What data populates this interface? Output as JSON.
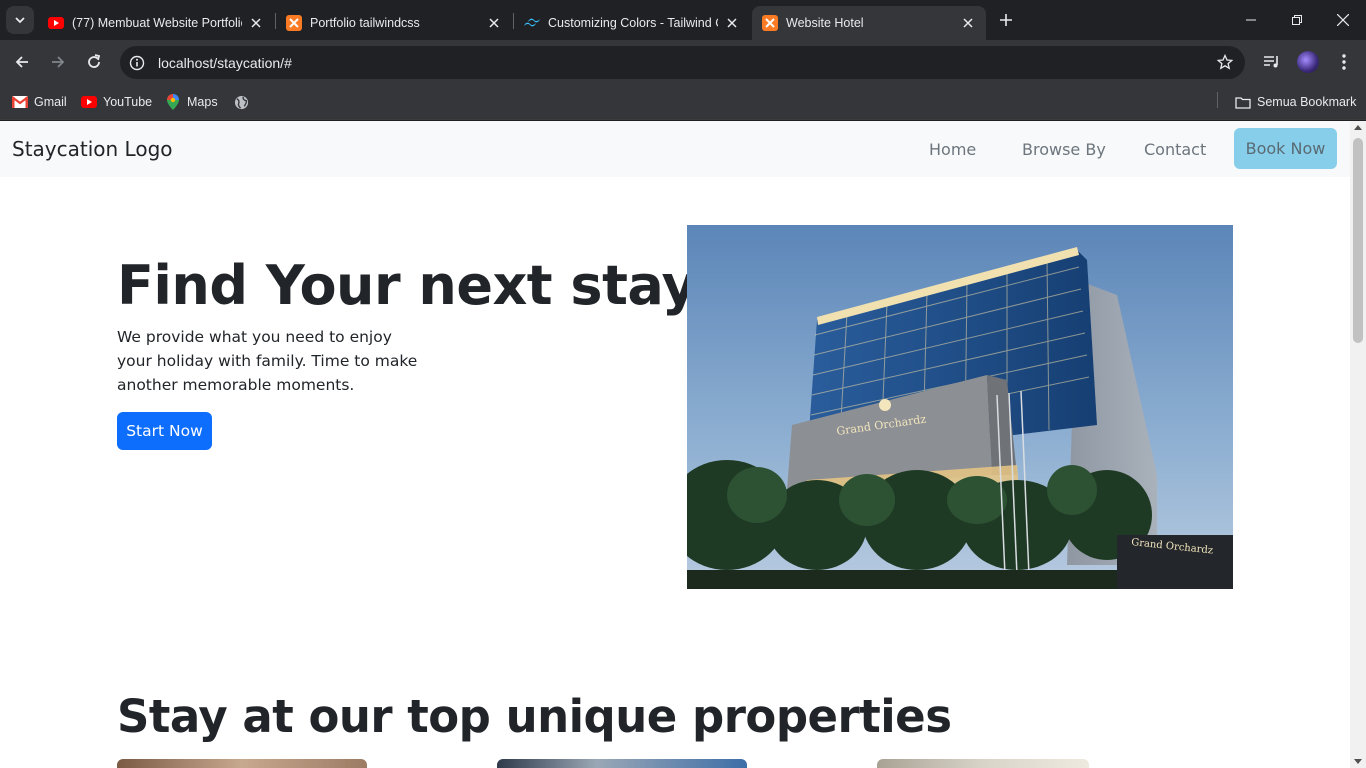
{
  "browser": {
    "tabs": [
      {
        "title": "(77) Membuat Website Portfolio",
        "favicon": "youtube-icon"
      },
      {
        "title": "Portfolio tailwindcss",
        "favicon": "xampp-icon"
      },
      {
        "title": "Customizing Colors - Tailwind CSS",
        "favicon": "tailwind-icon"
      },
      {
        "title": "Website Hotel",
        "favicon": "xampp-icon",
        "active": true
      }
    ],
    "url": "localhost/staycation/#",
    "bookmarks": [
      {
        "label": "Gmail",
        "icon": "gmail-icon"
      },
      {
        "label": "YouTube",
        "icon": "youtube-icon"
      },
      {
        "label": "Maps",
        "icon": "maps-icon"
      },
      {
        "label": "",
        "icon": "globe-icon"
      }
    ],
    "all_bookmarks_label": "Semua Bookmark"
  },
  "page": {
    "brand": "Staycation Logo",
    "nav": {
      "home": "Home",
      "browse": "Browse By",
      "contact": "Contact",
      "book_now": "Book Now"
    },
    "hero": {
      "title": "Find Your next stay",
      "description": "We provide what you need to enjoy your holiday with family. Time to make another memorable moments.",
      "cta": "Start Now",
      "image_sign_text": "Grand Orchardz",
      "image_sign_text_2": "Grand Orchardz"
    },
    "properties": {
      "title": "Stay at our top unique properties"
    }
  },
  "colors": {
    "primary": "#0d6efd",
    "book_now_bg": "#87ceeb",
    "navbar_bg": "#f8f9fa",
    "chrome_dark": "#202124",
    "chrome_toolbar": "#35363a"
  }
}
